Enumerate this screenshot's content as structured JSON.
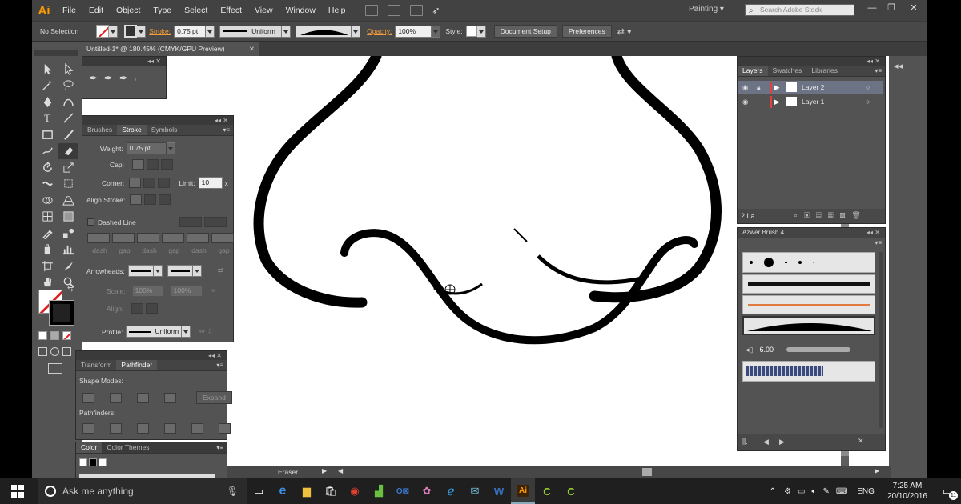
{
  "app": {
    "logo": "Ai",
    "menu": [
      "File",
      "Edit",
      "Object",
      "Type",
      "Select",
      "Effect",
      "View",
      "Window",
      "Help"
    ],
    "workspace": "Painting",
    "search_placeholder": "Search Adobe Stock"
  },
  "control_bar": {
    "selection": "No Selection",
    "stroke_label": "Stroke:",
    "stroke_weight": "0.75 pt",
    "profile": "Uniform",
    "opacity_label": "Opacity:",
    "opacity_value": "100%",
    "style_label": "Style:",
    "document_setup": "Document Setup",
    "preferences": "Preferences"
  },
  "document": {
    "tab_title": "Untitled-1* @ 180.45% (CMYK/GPU Preview)"
  },
  "stroke_panel": {
    "tabs": [
      "Brushes",
      "Stroke",
      "Symbols"
    ],
    "weight_label": "Weight:",
    "weight_value": "0.75 pt",
    "cap_label": "Cap:",
    "corner_label": "Corner:",
    "limit_label": "Limit:",
    "limit_value": "10",
    "limit_unit": "x",
    "align_label": "Align Stroke:",
    "dashed_label": "Dashed Line",
    "dash_labels": [
      "dash",
      "gap",
      "dash",
      "gap",
      "dash",
      "gap"
    ],
    "arrowheads_label": "Arrowheads:",
    "scale_label": "Scale:",
    "scale_value_1": "100%",
    "scale_value_2": "100%",
    "align_arrow_label": "Align:",
    "profile_label": "Profile:",
    "profile_value": "Uniform"
  },
  "pathfinder_panel": {
    "tabs": [
      "Transform",
      "Pathfinder"
    ],
    "shape_modes_label": "Shape Modes:",
    "expand_label": "Expand",
    "pathfinders_label": "Pathfinders:"
  },
  "color_panel": {
    "tabs": [
      "Color",
      "Color Themes"
    ]
  },
  "layers_panel": {
    "tabs": [
      "Layers",
      "Swatches",
      "Libraries"
    ],
    "layers": [
      {
        "name": "Layer 2",
        "color": "#e04040",
        "selected": true
      },
      {
        "name": "Layer 1",
        "color": "#e04040",
        "selected": false
      }
    ],
    "count": "2 La..."
  },
  "brush_panel": {
    "title": "Azwer Brush 4",
    "brush_size": "6.00"
  },
  "status": {
    "tool": "Eraser"
  },
  "taskbar": {
    "search_placeholder": "Ask me anything",
    "language": "ENG",
    "time": "7:25 AM",
    "date": "20/10/2016",
    "notifications": "11"
  }
}
